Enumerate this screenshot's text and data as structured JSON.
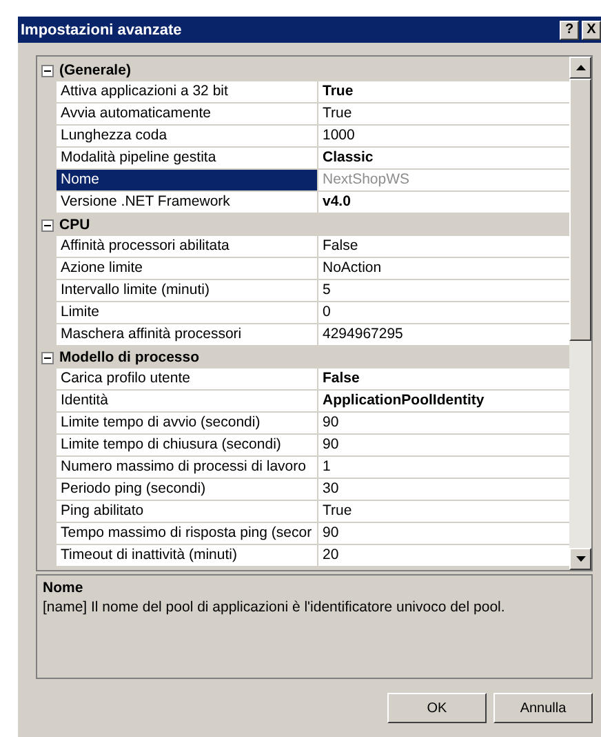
{
  "window": {
    "title": "Impostazioni avanzate",
    "help_button": "?",
    "close_button": "X"
  },
  "categories": [
    {
      "name": "(Generale)",
      "expanded": true,
      "properties": [
        {
          "name": "Attiva applicazioni a 32 bit",
          "value": "True",
          "bold": true,
          "selected": false,
          "readonly": false
        },
        {
          "name": "Avvia automaticamente",
          "value": "True",
          "bold": false,
          "selected": false,
          "readonly": false
        },
        {
          "name": "Lunghezza coda",
          "value": "1000",
          "bold": false,
          "selected": false,
          "readonly": false
        },
        {
          "name": "Modalità pipeline gestita",
          "value": "Classic",
          "bold": true,
          "selected": false,
          "readonly": false
        },
        {
          "name": "Nome",
          "value": "NextShopWS",
          "bold": false,
          "selected": true,
          "readonly": true
        },
        {
          "name": "Versione .NET Framework",
          "value": "v4.0",
          "bold": true,
          "selected": false,
          "readonly": false
        }
      ]
    },
    {
      "name": "CPU",
      "expanded": true,
      "properties": [
        {
          "name": "Affinità processori abilitata",
          "value": "False",
          "bold": false,
          "selected": false,
          "readonly": false
        },
        {
          "name": "Azione limite",
          "value": "NoAction",
          "bold": false,
          "selected": false,
          "readonly": false
        },
        {
          "name": "Intervallo limite (minuti)",
          "value": "5",
          "bold": false,
          "selected": false,
          "readonly": false
        },
        {
          "name": "Limite",
          "value": "0",
          "bold": false,
          "selected": false,
          "readonly": false
        },
        {
          "name": "Maschera affinità processori",
          "value": "4294967295",
          "bold": false,
          "selected": false,
          "readonly": false
        }
      ]
    },
    {
      "name": "Modello di processo",
      "expanded": true,
      "properties": [
        {
          "name": "Carica profilo utente",
          "value": "False",
          "bold": true,
          "selected": false,
          "readonly": false
        },
        {
          "name": "Identità",
          "value": "ApplicationPoolIdentity",
          "bold": true,
          "selected": false,
          "readonly": false
        },
        {
          "name": "Limite tempo di avvio (secondi)",
          "value": "90",
          "bold": false,
          "selected": false,
          "readonly": false
        },
        {
          "name": "Limite tempo di chiusura (secondi)",
          "value": "90",
          "bold": false,
          "selected": false,
          "readonly": false
        },
        {
          "name": "Numero massimo di processi di lavoro",
          "value": "1",
          "bold": false,
          "selected": false,
          "readonly": false
        },
        {
          "name": "Periodo ping (secondi)",
          "value": "30",
          "bold": false,
          "selected": false,
          "readonly": false
        },
        {
          "name": "Ping abilitato",
          "value": "True",
          "bold": false,
          "selected": false,
          "readonly": false
        },
        {
          "name": "Tempo massimo di risposta ping (secor",
          "value": "90",
          "bold": false,
          "selected": false,
          "readonly": false
        },
        {
          "name": "Timeout di inattività (minuti)",
          "value": "20",
          "bold": false,
          "selected": false,
          "readonly": false
        }
      ]
    }
  ],
  "description": {
    "title": "Nome",
    "text": "[name] Il nome del pool di applicazioni è l'identificatore univoco del pool."
  },
  "buttons": [
    "OK",
    "Annulla"
  ]
}
